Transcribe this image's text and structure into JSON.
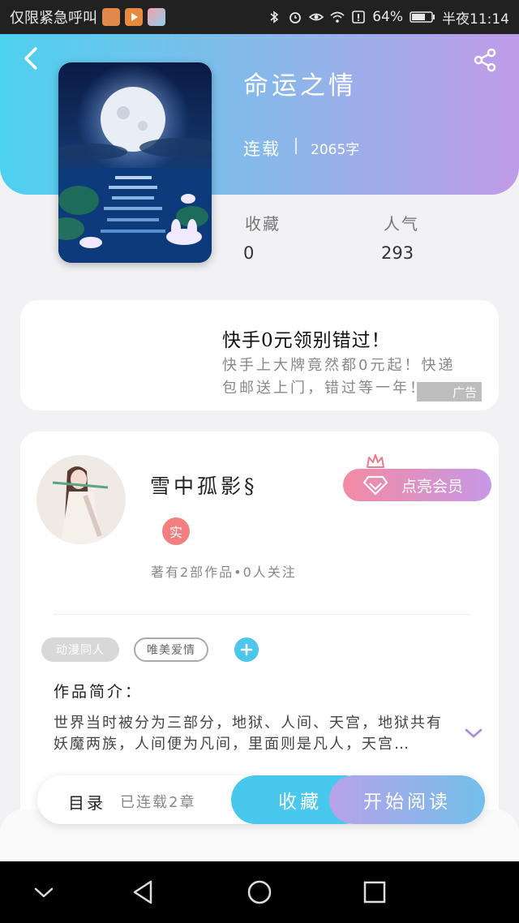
{
  "status_bar": {
    "carrier_text": "仅限紧急呼叫",
    "battery": "64%",
    "time": "半夜11:14",
    "app_icons": [
      "squirrel-app-icon",
      "video-app-icon",
      "grid-app-icon"
    ],
    "system_icons": [
      "bluetooth-icon",
      "alarm-icon",
      "eye-icon",
      "wifi-icon",
      "alert-icon",
      "battery-icon"
    ]
  },
  "book": {
    "title": "命运之情",
    "status": "连载",
    "word_count": "2065字",
    "favorites_label": "收藏",
    "favorites_value": "0",
    "popularity_label": "人气",
    "popularity_value": "293"
  },
  "ad": {
    "title": "快手0元领别错过！",
    "description": "快手上大牌竟然都0元起！快递包邮送上门，错过等一年！",
    "badge": "广告"
  },
  "author": {
    "name": "雪中孤影§",
    "verified_label": "实",
    "vip_button": "点亮会员",
    "meta": "著有2部作品•0人关注"
  },
  "tags": [
    "动漫同人",
    "唯美爱情"
  ],
  "intro": {
    "heading": "作品简介：",
    "text": "世界当时被分为三部分，地狱、人间、天宫，地狱共有妖魔两族，人间便为凡间，里面则是凡人，天宫…"
  },
  "bottom_bar": {
    "toc_label": "目录",
    "toc_status": "已连载2章",
    "favorite_button": "收藏",
    "read_button": "开始阅读"
  },
  "colors": {
    "header_gradient_start": "#4dd1ee",
    "header_gradient_end": "#c09be8",
    "accent_blue": "#47c8ec",
    "vip_gradient_start": "#f48aa2",
    "vip_gradient_end": "#c698e6",
    "verified_badge": "#f28080"
  }
}
